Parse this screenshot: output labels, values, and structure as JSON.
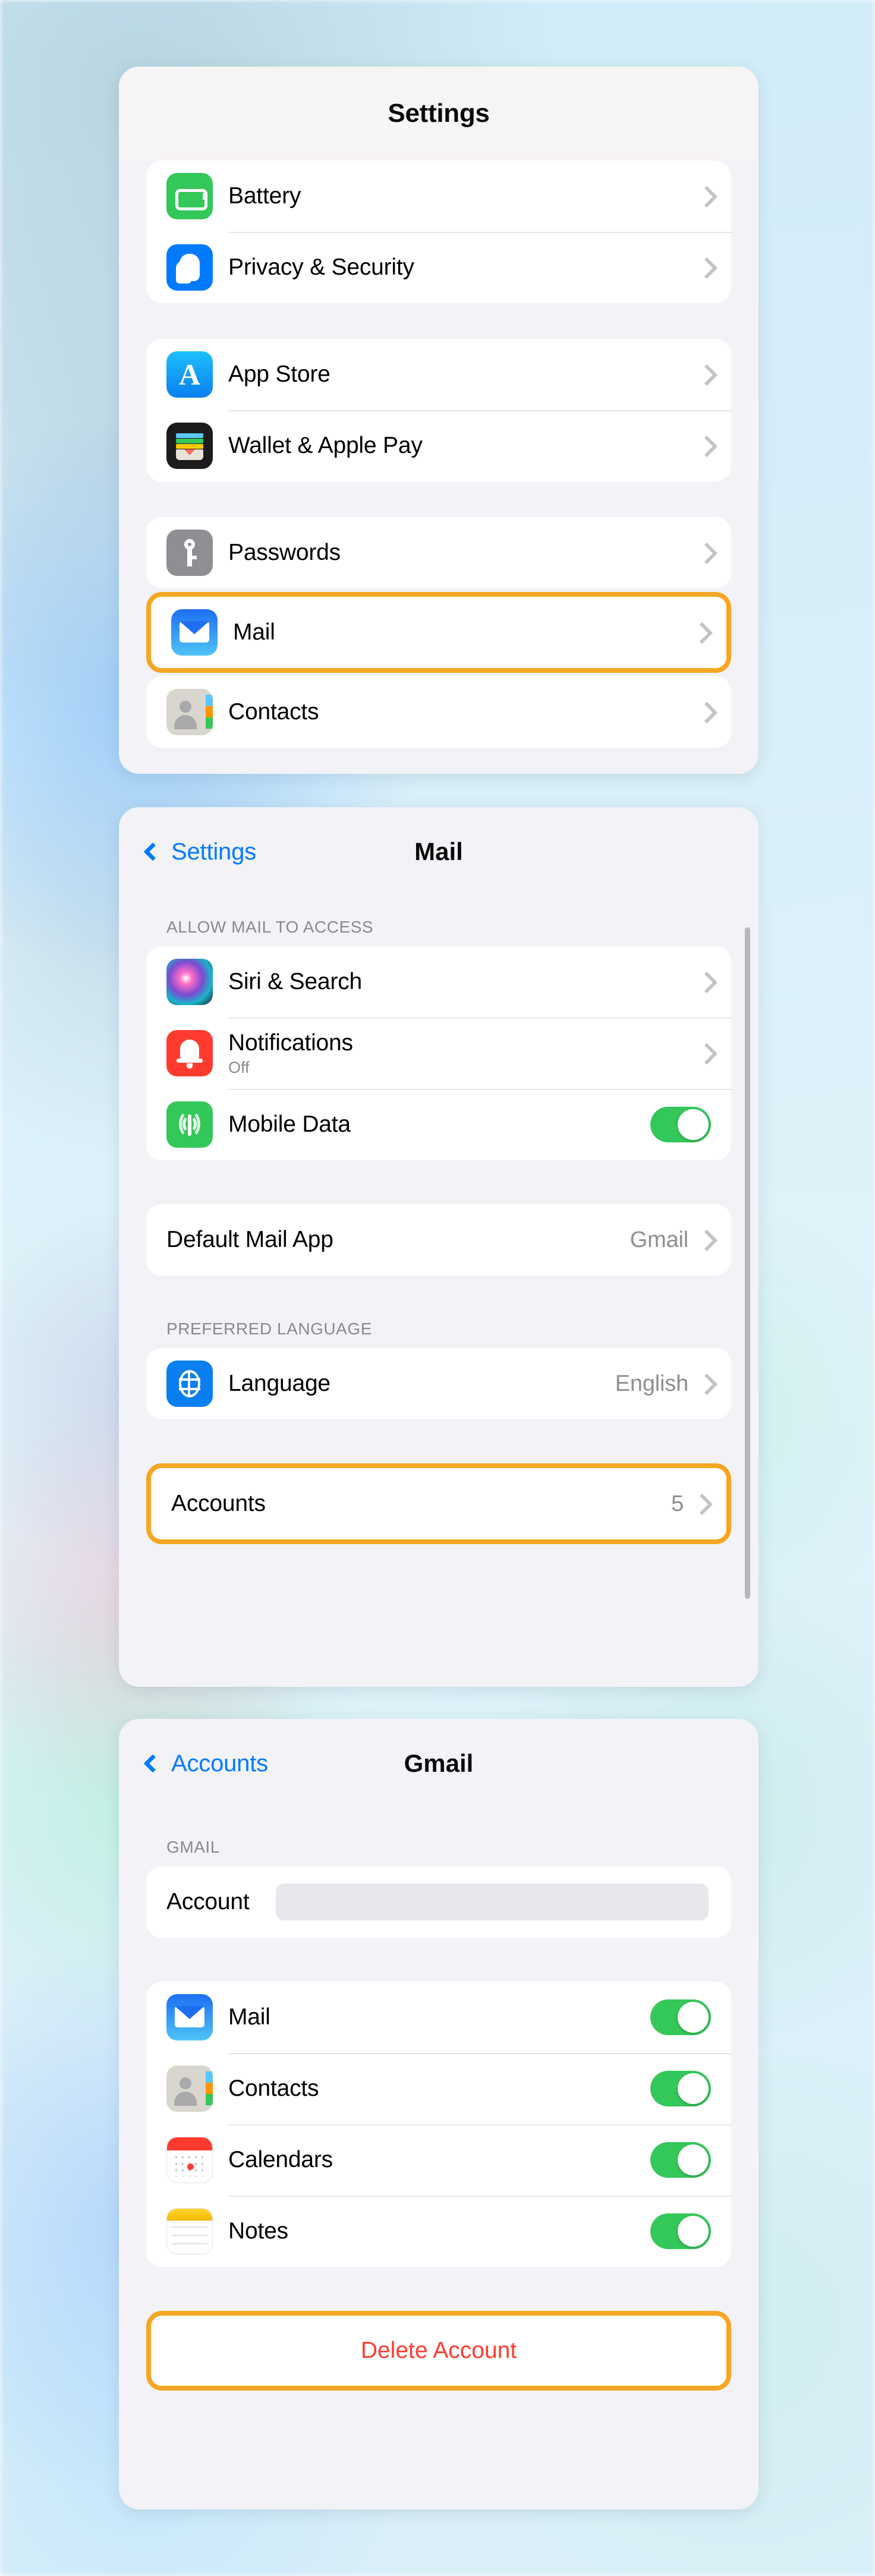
{
  "background": {
    "description": "blurred iOS home screen",
    "tint": "#d2ecf8"
  },
  "highlight_color": "#f5a623",
  "accent_color": "#007aff",
  "toggle_on_color": "#34c759",
  "danger_color": "#ff3b30",
  "panels": {
    "settings": {
      "title": "Settings",
      "groups": [
        {
          "rows": [
            {
              "label": "Battery",
              "icon": "battery-icon",
              "accessory": "chevron"
            },
            {
              "label": "Privacy & Security",
              "icon": "privacy-icon",
              "accessory": "chevron"
            }
          ]
        },
        {
          "rows": [
            {
              "label": "App Store",
              "icon": "app-store-icon",
              "accessory": "chevron"
            },
            {
              "label": "Wallet & Apple Pay",
              "icon": "wallet-icon",
              "accessory": "chevron"
            }
          ]
        },
        {
          "rows": [
            {
              "label": "Passwords",
              "icon": "passwords-icon",
              "accessory": "chevron",
              "highlighted": false
            },
            {
              "label": "Mail",
              "icon": "mail-icon",
              "accessory": "chevron",
              "highlighted": true
            },
            {
              "label": "Contacts",
              "icon": "contacts-icon",
              "accessory": "chevron",
              "highlighted": false
            }
          ]
        }
      ]
    },
    "mail": {
      "back_label": "Settings",
      "title": "Mail",
      "section_allow": "ALLOW MAIL TO ACCESS",
      "rows_allow": [
        {
          "label": "Siri & Search",
          "icon": "siri-icon",
          "accessory": "chevron"
        },
        {
          "label": "Notifications",
          "icon": "notifications-icon",
          "sub": "Off",
          "accessory": "chevron"
        },
        {
          "label": "Mobile Data",
          "icon": "mobile-data-icon",
          "accessory": "toggle",
          "value": "on"
        }
      ],
      "default_mail_app": {
        "label": "Default Mail App",
        "value": "Gmail",
        "accessory": "chevron"
      },
      "section_language": "PREFERRED LANGUAGE",
      "language": {
        "label": "Language",
        "icon": "language-icon",
        "value": "English",
        "accessory": "chevron"
      },
      "accounts": {
        "label": "Accounts",
        "value": "5",
        "accessory": "chevron",
        "highlighted": true
      }
    },
    "gmail": {
      "back_label": "Accounts",
      "title": "Gmail",
      "section_gmail": "GMAIL",
      "account_row": {
        "label": "Account",
        "value": "",
        "redacted": true
      },
      "toggles": [
        {
          "label": "Mail",
          "icon": "mail-icon",
          "value": "on"
        },
        {
          "label": "Contacts",
          "icon": "contacts-icon",
          "value": "on"
        },
        {
          "label": "Calendars",
          "icon": "calendars-icon",
          "value": "on"
        },
        {
          "label": "Notes",
          "icon": "notes-icon",
          "value": "on"
        }
      ],
      "delete_button": {
        "label": "Delete Account",
        "highlighted": true
      }
    }
  }
}
